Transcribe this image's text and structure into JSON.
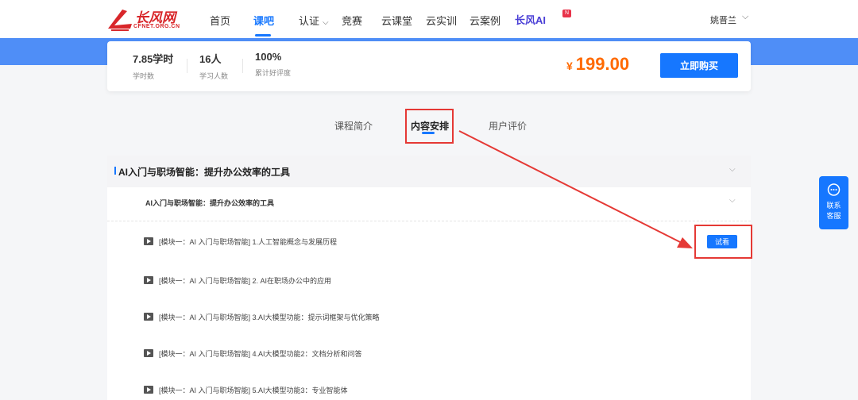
{
  "header": {
    "logo_text": "长风网",
    "logo_sub": "CFNET.ORG.CN",
    "nav": [
      {
        "label": "首页"
      },
      {
        "label": "课吧"
      },
      {
        "label": "认证"
      },
      {
        "label": "竞赛"
      },
      {
        "label": "云课堂"
      },
      {
        "label": "云实训"
      },
      {
        "label": "云案例"
      }
    ],
    "active_nav": "课吧",
    "ai_brand": "长风AI",
    "ai_badge": "N",
    "username": "姚晋兰"
  },
  "summary": {
    "stats": [
      {
        "value": "7.85学时",
        "label": "学时数"
      },
      {
        "value": "16人",
        "label": "学习人数"
      },
      {
        "value": "100%",
        "label": "累计好评度"
      }
    ],
    "currency": "¥",
    "price": "199.00",
    "buy_label": "立即购买"
  },
  "tabs": [
    {
      "label": "课程简介"
    },
    {
      "label": "内容安排"
    },
    {
      "label": "用户评价"
    }
  ],
  "active_tab": "内容安排",
  "content": {
    "section_title": "AI入门与职场智能：提升办公效率的工具",
    "subsection_title": "AI入门与职场智能：提升办公效率的工具",
    "lessons": [
      {
        "title": "[模块一：AI 入门与职场智能] 1.人工智能概念与发展历程"
      },
      {
        "title": "[模块一：AI 入门与职场智能] 2. AI在职场办公中的应用"
      },
      {
        "title": "[模块一：AI 入门与职场智能] 3.AI大模型功能：提示词框架与优化策略"
      },
      {
        "title": "[模块一：AI 入门与职场智能] 4.AI大模型功能2：文档分析和问答"
      },
      {
        "title": "[模块一：AI 入门与职场智能] 5.AI大模型功能3：专业智能体"
      }
    ],
    "trial_label": "试看"
  },
  "service": {
    "label_line1": "联系",
    "label_line2": "客服"
  },
  "colors": {
    "accent": "#1677ff",
    "band": "#4f8ef7",
    "price": "#ff6a00",
    "annotation": "#e53935",
    "brand_red": "#d8262a"
  }
}
